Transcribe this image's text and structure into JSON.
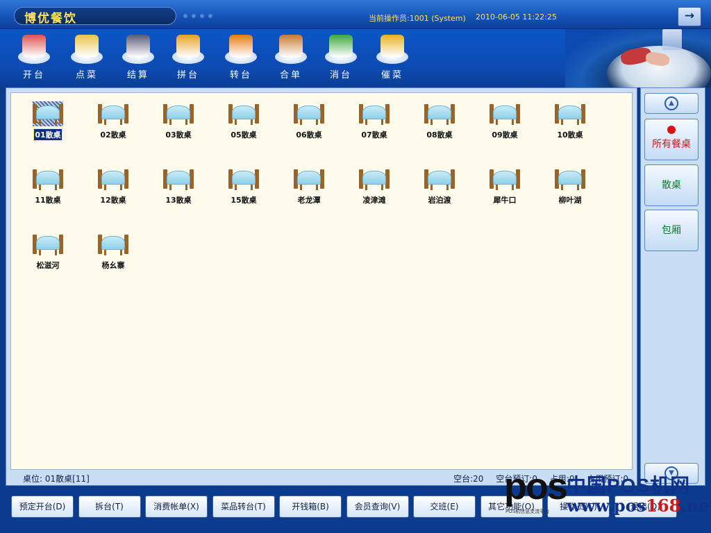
{
  "titlebar": {
    "app_title": "博优餐饮",
    "operator": "当前操作员:1001 (System)",
    "datetime": "2010-06-05 11:22:25",
    "exit_icon": "→"
  },
  "toolbar": {
    "items": [
      {
        "label": "开台",
        "icon": "open-table-icon",
        "color": "#e05050"
      },
      {
        "label": "点菜",
        "icon": "order-dishes-icon",
        "color": "#e8c34a"
      },
      {
        "label": "结算",
        "icon": "checkout-icon",
        "color": "#5a5a7a"
      },
      {
        "label": "拼台",
        "icon": "merge-tables-icon",
        "color": "#e8a020"
      },
      {
        "label": "转台",
        "icon": "transfer-table-icon",
        "color": "#e67a10"
      },
      {
        "label": "合单",
        "icon": "merge-bill-icon",
        "color": "#c87830"
      },
      {
        "label": "消台",
        "icon": "clear-table-icon",
        "color": "#3aa83a"
      },
      {
        "label": "催菜",
        "icon": "rush-dishes-icon",
        "color": "#e8b020"
      }
    ]
  },
  "tables": [
    {
      "label": "01散桌",
      "selected": true
    },
    {
      "label": "02散桌"
    },
    {
      "label": "03散桌"
    },
    {
      "label": "05散桌"
    },
    {
      "label": "06散桌"
    },
    {
      "label": "07散桌"
    },
    {
      "label": "08散桌"
    },
    {
      "label": "09散桌"
    },
    {
      "label": "10散桌"
    },
    {
      "label": "11散桌"
    },
    {
      "label": "12散桌"
    },
    {
      "label": "13散桌"
    },
    {
      "label": "15散桌"
    },
    {
      "label": "老龙潭"
    },
    {
      "label": "凌津滩"
    },
    {
      "label": "岩泊渡"
    },
    {
      "label": "犀牛口"
    },
    {
      "label": "柳叶湖"
    },
    {
      "label": "松滋河"
    },
    {
      "label": "杨幺寨"
    }
  ],
  "status": {
    "seat": "桌位: 01散桌[11]",
    "empty": "空台:20",
    "empty_reserved": "空台预订:0",
    "occupied": "占用:0",
    "occupied_reserved": "占用预订:0"
  },
  "side": {
    "all_tables": "所有餐桌",
    "open_seating": "散桌",
    "private_room": "包厢",
    "up_icon": "▲",
    "down_icon": "▼"
  },
  "bottom_buttons": [
    "预定开台(D)",
    "拆台(T)",
    "消费帐单(X)",
    "菜品转台(T)",
    "开钱箱(B)",
    "会员查询(V)",
    "交班(E)",
    "其它功能(O)",
    "操作员(C)",
    "退出(Q)"
  ],
  "watermark": {
    "logo": "pos",
    "cn_name": "中国POS机网",
    "url_pre": "www.pos",
    "url_num": "168",
    "url_post": ".net",
    "sub": "POS机信息交流平台"
  }
}
